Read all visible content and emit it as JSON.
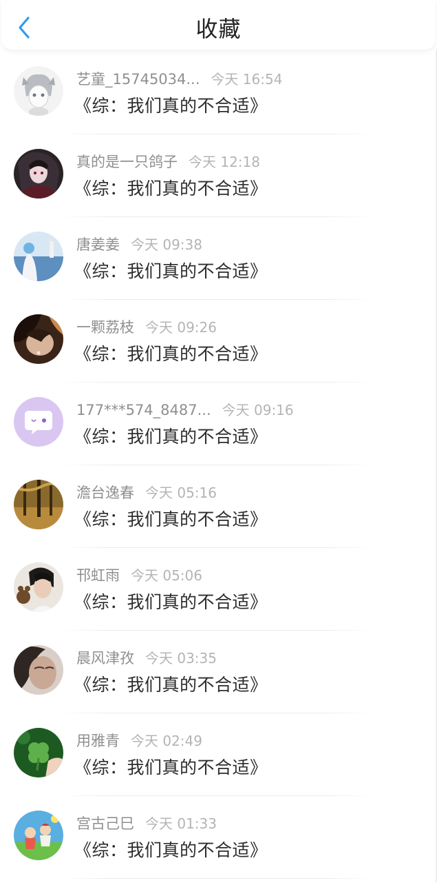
{
  "header": {
    "title": "收藏"
  },
  "items": [
    {
      "name": "艺童_15745034...",
      "time": "今天 16:54",
      "content": "《综：我们真的不合适》"
    },
    {
      "name": "真的是一只鸽子",
      "time": "今天 12:18",
      "content": "《综：我们真的不合适》"
    },
    {
      "name": "唐姜姜",
      "time": "今天 09:38",
      "content": "《综：我们真的不合适》"
    },
    {
      "name": "一颗荔枝",
      "time": "今天 09:26",
      "content": "《综：我们真的不合适》"
    },
    {
      "name": "177***574_8487...",
      "time": "今天 09:16",
      "content": "《综：我们真的不合适》"
    },
    {
      "name": "澹台逸春",
      "time": "今天 05:16",
      "content": "《综：我们真的不合适》"
    },
    {
      "name": "邗虹雨",
      "time": "今天 05:06",
      "content": "《综：我们真的不合适》"
    },
    {
      "name": "晨风津孜",
      "time": "今天 03:35",
      "content": "《综：我们真的不合适》"
    },
    {
      "name": "用雅青",
      "time": "今天 02:49",
      "content": "《综：我们真的不合适》"
    },
    {
      "name": "宫古己巳",
      "time": "今天 01:33",
      "content": "《综：我们真的不合适》"
    }
  ]
}
